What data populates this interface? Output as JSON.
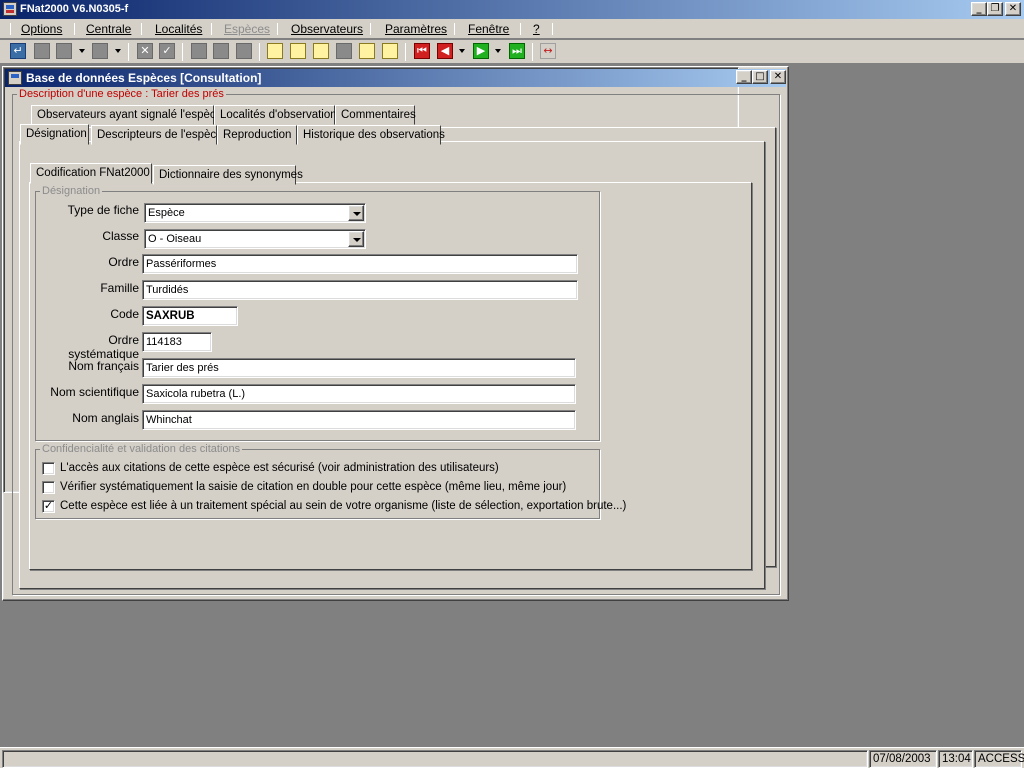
{
  "app": {
    "title": "FNat2000 V6.N0305-f",
    "caption_buttons": {
      "minimize": "_",
      "restore": "❐",
      "close": "✕"
    }
  },
  "menu": {
    "items": [
      {
        "label": "Options",
        "enabled": true
      },
      {
        "label": "Centrale",
        "enabled": true
      },
      {
        "label": "Localités",
        "enabled": true
      },
      {
        "label": "Espèces",
        "enabled": false
      },
      {
        "label": "Observateurs",
        "enabled": true
      },
      {
        "label": "Paramètres",
        "enabled": true
      },
      {
        "label": "Fenêtre",
        "enabled": true
      },
      {
        "label": "?",
        "enabled": true
      }
    ]
  },
  "toolbar": {
    "icons": {
      "back": "back-arrow-icon",
      "first": "first-record-icon",
      "prev": "previous-record-icon",
      "next": "next-record-icon",
      "last": "last-record-icon",
      "swap": "swap-icon"
    },
    "glyphs": {
      "back": "↵",
      "cancel": "✕",
      "check": "✓",
      "first": "⏮",
      "prev": "◀",
      "next": "▶",
      "last": "⏭",
      "swap": "↔"
    }
  },
  "window": {
    "title": "Base de données Espèces [Consultation]",
    "caption_buttons": {
      "minimize": "_",
      "maximize": "□",
      "close": "✕"
    }
  },
  "description_group": {
    "legend": "Description d'une espèce : Tarier des prés"
  },
  "tabs_row1": [
    "Observateurs ayant signalé l'espèce",
    "Localités d'observation",
    "Commentaires"
  ],
  "tabs_row2": [
    "Désignation",
    "Descripteurs de l'espèce",
    "Reproduction",
    "Historique des observations"
  ],
  "active_tab": "Désignation",
  "subtabs": [
    "Codification FNat2000",
    "Dictionnaire des synonymes"
  ],
  "active_subtab": "Codification FNat2000",
  "designation": {
    "legend": "Désignation",
    "type_fiche": {
      "label": "Type de fiche",
      "value": "Espèce"
    },
    "classe": {
      "label": "Classe",
      "value": "O - Oiseau"
    },
    "ordre": {
      "label": "Ordre",
      "value": "Passériformes"
    },
    "famille": {
      "label": "Famille",
      "value": "Turdidés"
    },
    "code": {
      "label": "Code",
      "value": "SAXRUB"
    },
    "ordre_sys": {
      "label": "Ordre systématique",
      "value": "114183"
    },
    "nom_francais": {
      "label": "Nom français",
      "value": "Tarier des prés"
    },
    "nom_scientifique": {
      "label": "Nom scientifique",
      "value": "Saxicola rubetra (L.)"
    },
    "nom_anglais": {
      "label": "Nom anglais",
      "value": "Whinchat"
    }
  },
  "confidentialite": {
    "legend": "Confidencialité et validation des citations",
    "options": [
      {
        "label": "L'accès aux citations de cette espèce est sécurisé (voir administration des utilisateurs)",
        "checked": false
      },
      {
        "label": "Vérifier systématiquement la saisie de citation en double pour cette espèce (même lieu, même jour)",
        "checked": false
      },
      {
        "label": "Cette espèce est liée à un traitement spécial au sein de votre organisme (liste de sélection, exportation brute...)",
        "checked": true
      }
    ],
    "check_glyph": "✓"
  },
  "status": {
    "date": "07/08/2003",
    "time": "13:04",
    "mode": "ACCESS"
  }
}
